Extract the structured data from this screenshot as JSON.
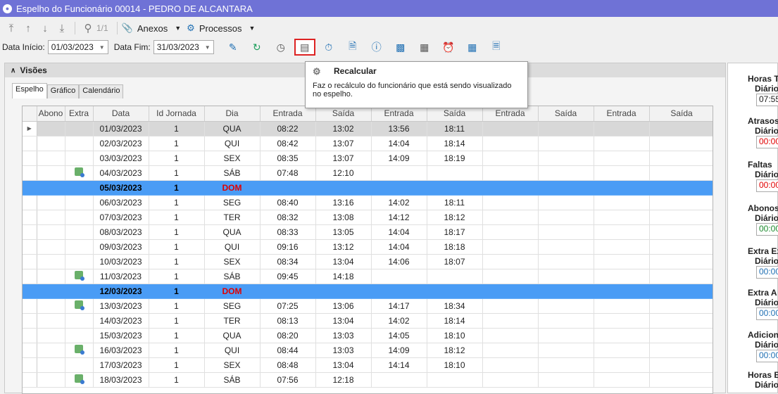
{
  "window": {
    "title": "Espelho do Funcionário 00014 - PEDRO DE ALCANTARA"
  },
  "toolbar1": {
    "page_indicator": "1/1",
    "anexos_label": "Anexos",
    "processos_label": "Processos"
  },
  "toolbar2": {
    "data_inicio_label": "Data Início:",
    "data_inicio_value": "01/03/2023",
    "data_fim_label": "Data Fim:",
    "data_fim_value": "31/03/2023"
  },
  "visoes": {
    "title": "Visões"
  },
  "tabs": [
    "Espelho",
    "Gráfico",
    "Calendário"
  ],
  "grid": {
    "columns": [
      "Abono",
      "Extra",
      "Data",
      "Id Jornada",
      "Dia",
      "Entrada",
      "Saída",
      "Entrada",
      "Saída",
      "Entrada",
      "Saída",
      "Entrada",
      "Saída"
    ],
    "rows": [
      {
        "extra": false,
        "data": "01/03/2023",
        "jornada": "1",
        "dia": "QUA",
        "e1": "08:22",
        "s1": "13:02",
        "e2": "13:56",
        "s2": "18:11",
        "type": "sel"
      },
      {
        "extra": false,
        "data": "02/03/2023",
        "jornada": "1",
        "dia": "QUI",
        "e1": "08:42",
        "s1": "13:07",
        "e2": "14:04",
        "s2": "18:14",
        "type": ""
      },
      {
        "extra": false,
        "data": "03/03/2023",
        "jornada": "1",
        "dia": "SEX",
        "e1": "08:35",
        "s1": "13:07",
        "e2": "14:09",
        "s2": "18:19",
        "type": ""
      },
      {
        "extra": true,
        "data": "04/03/2023",
        "jornada": "1",
        "dia": "SÁB",
        "e1": "07:48",
        "s1": "12:10",
        "e2": "",
        "s2": "",
        "type": ""
      },
      {
        "extra": false,
        "data": "05/03/2023",
        "jornada": "1",
        "dia": "DOM",
        "e1": "",
        "s1": "",
        "e2": "",
        "s2": "",
        "type": "sun"
      },
      {
        "extra": false,
        "data": "06/03/2023",
        "jornada": "1",
        "dia": "SEG",
        "e1": "08:40",
        "s1": "13:16",
        "e2": "14:02",
        "s2": "18:11",
        "type": ""
      },
      {
        "extra": false,
        "data": "07/03/2023",
        "jornada": "1",
        "dia": "TER",
        "e1": "08:32",
        "s1": "13:08",
        "e2": "14:12",
        "s2": "18:12",
        "type": ""
      },
      {
        "extra": false,
        "data": "08/03/2023",
        "jornada": "1",
        "dia": "QUA",
        "e1": "08:33",
        "s1": "13:05",
        "e2": "14:04",
        "s2": "18:17",
        "type": ""
      },
      {
        "extra": false,
        "data": "09/03/2023",
        "jornada": "1",
        "dia": "QUI",
        "e1": "09:16",
        "s1": "13:12",
        "e2": "14:04",
        "s2": "18:18",
        "type": ""
      },
      {
        "extra": false,
        "data": "10/03/2023",
        "jornada": "1",
        "dia": "SEX",
        "e1": "08:34",
        "s1": "13:04",
        "e2": "14:06",
        "s2": "18:07",
        "type": ""
      },
      {
        "extra": true,
        "data": "11/03/2023",
        "jornada": "1",
        "dia": "SÁB",
        "e1": "09:45",
        "s1": "14:18",
        "e2": "",
        "s2": "",
        "type": ""
      },
      {
        "extra": false,
        "data": "12/03/2023",
        "jornada": "1",
        "dia": "DOM",
        "e1": "",
        "s1": "",
        "e2": "",
        "s2": "",
        "type": "sun"
      },
      {
        "extra": true,
        "data": "13/03/2023",
        "jornada": "1",
        "dia": "SEG",
        "e1": "07:25",
        "s1": "13:06",
        "e2": "14:17",
        "s2": "18:34",
        "type": ""
      },
      {
        "extra": false,
        "data": "14/03/2023",
        "jornada": "1",
        "dia": "TER",
        "e1": "08:13",
        "s1": "13:04",
        "e2": "14:02",
        "s2": "18:14",
        "type": ""
      },
      {
        "extra": false,
        "data": "15/03/2023",
        "jornada": "1",
        "dia": "QUA",
        "e1": "08:20",
        "s1": "13:03",
        "e2": "14:05",
        "s2": "18:10",
        "type": ""
      },
      {
        "extra": true,
        "data": "16/03/2023",
        "jornada": "1",
        "dia": "QUI",
        "e1": "08:44",
        "s1": "13:03",
        "e2": "14:09",
        "s2": "18:12",
        "type": ""
      },
      {
        "extra": false,
        "data": "17/03/2023",
        "jornada": "1",
        "dia": "SEX",
        "e1": "08:48",
        "s1": "13:04",
        "e2": "14:14",
        "s2": "18:10",
        "type": ""
      },
      {
        "extra": true,
        "data": "18/03/2023",
        "jornada": "1",
        "dia": "SÁB",
        "e1": "07:56",
        "s1": "12:18",
        "e2": "",
        "s2": "",
        "type": ""
      }
    ]
  },
  "tooltip": {
    "title": "Recalcular",
    "body": "Faz o recálculo do funcionário que está sendo visualizado no espelho."
  },
  "right_panel": {
    "sections": [
      {
        "title": "Horas T",
        "sub": "Diário",
        "value": "07:55",
        "color": ""
      },
      {
        "title": "Atrasos",
        "sub": "Diário",
        "value": "00:00",
        "color": "red"
      },
      {
        "title": "Faltas",
        "sub": "Diário",
        "value": "00:00",
        "color": "red"
      },
      {
        "title": "Abonos",
        "sub": "Diário",
        "value": "00:00",
        "color": "green"
      },
      {
        "title": "Extra Ex",
        "sub": "Diário",
        "value": "00:00",
        "color": "blue"
      },
      {
        "title": "Extra A",
        "sub": "Diário",
        "value": "00:00",
        "color": "blue"
      },
      {
        "title": "Adiciona",
        "sub": "Diário",
        "value": "00:00",
        "color": "blue"
      },
      {
        "title": "Horas B",
        "sub": "Diário",
        "value": "",
        "color": ""
      }
    ]
  },
  "colors": {
    "titlebar": "#6f72d6",
    "sunday_row": "#4a9cf5",
    "highlight_border": "#dd2222"
  }
}
